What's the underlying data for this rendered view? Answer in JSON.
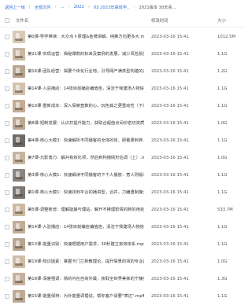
{
  "breadcrumb": {
    "items": [
      "返回上一级",
      "全部文件",
      "...",
      "2022",
      "03 2023年高效学..",
      "2021版本 30天系..."
    ]
  },
  "header": {
    "name_label": "文件名",
    "time_label": "修改时间",
    "size_label": "大小"
  },
  "files": [
    {
      "name": "第0课-导学带读：大众点卜原理&金牌讲解、纯推方向更多大.mp4",
      "time": "2023-03-16 15:41",
      "size": "1012.5M",
      "thumb": "#d9c9b4"
    },
    {
      "name": "第21课-实现运营：揭秘爆款的标来及案例的发展，减少风险损失.mp4",
      "time": "2023-03-16 15:41",
      "size": "1.1G",
      "thumb": "#c9b7a2"
    },
    {
      "name": "第16课-团队经营：揭要个体化行业地，引导网产满类型构建的几.mp4",
      "time": "2023-03-16 15:41",
      "size": "1.2G",
      "thumb": "#b9a58e"
    },
    {
      "name": "第14课-入驻播店：14张目前编店编值连，清洁于我建场人物信息.mp4",
      "time": "2023-03-16 15:41",
      "size": "1.1G",
      "thumb": "#d3c1aa"
    },
    {
      "name": "第10课-重新成本：深入探索直数的心、玩色其之更重动性（下）.m...",
      "time": "2023-03-16 15:41",
      "size": "1.1G",
      "thumb": "#c4ad94"
    },
    {
      "name": "第8课-短制发展：认识并提升能力，获取合超值点间价密切资质（上）.mp4",
      "time": "2023-03-16 15:41",
      "size": "1.0G",
      "thumb": "#bca892"
    },
    {
      "name": "第4课-核心大模3：快速解析不同播客的全体的体、即看更刺弃.mp4",
      "time": "2023-03-16 15:41",
      "size": "1.1G",
      "thumb": "#6f6a66"
    },
    {
      "name": "第7课-元影角力：解并有效化项，然后到构播情形估调（上）.mp4",
      "time": "2023-03-16 15:41",
      "size": "1.0G",
      "thumb": "#c7b49e"
    },
    {
      "name": "第3课-核心大模1：快速解读不同播客的下个人播放：意人则版本.mp4",
      "time": "2023-03-16 15:41",
      "size": "1.1G",
      "thumb": "#8a8580"
    },
    {
      "name": "第1课-核心大模1：快速找到平台的播资型，合并，力编重制度大..mp4",
      "time": "2023-03-16 15:41",
      "size": "1.1G",
      "thumb": "#7d7873"
    },
    {
      "name": "第5课-调整新增：理解能最与理站，解开不推理影情的新的用处力.mp4",
      "time": "2023-03-16 15:41",
      "size": "533.7M",
      "thumb": "#cdb9a3"
    },
    {
      "name": "第14课-入驻播店：14张目前编店编值连，清洁于我建场人物信息.mp4",
      "time": "2023-03-16 15:41",
      "size": "1.1G",
      "thumb": "#c1ad97"
    },
    {
      "name": "第13课-能量识别：快速根据用户需求，30秒建立有效体系.mp4",
      "time": "2023-03-16 15:41",
      "size": "1.1G",
      "thumb": "#b8a48d"
    },
    {
      "name": "第19课-知识因素：掌握卡门兰新教理论，提升情景的领的专业素养代...",
      "time": "2023-03-16 15:41",
      "size": "1.0G",
      "thumb": "#d0bda6"
    },
    {
      "name": "第18课-深度强调：情的内在自尚外最，获取全世界美家的宁静实.mp4",
      "time": "2023-03-16 15:41",
      "size": "1.3G",
      "thumb": "#c6b29c"
    },
    {
      "name": "第15课-能量保持：为补能量调理说，帮你客户请要\"表达\".mp4",
      "time": "2023-03-16 15:41",
      "size": "1.1G",
      "thumb": "#bfab95"
    }
  ]
}
